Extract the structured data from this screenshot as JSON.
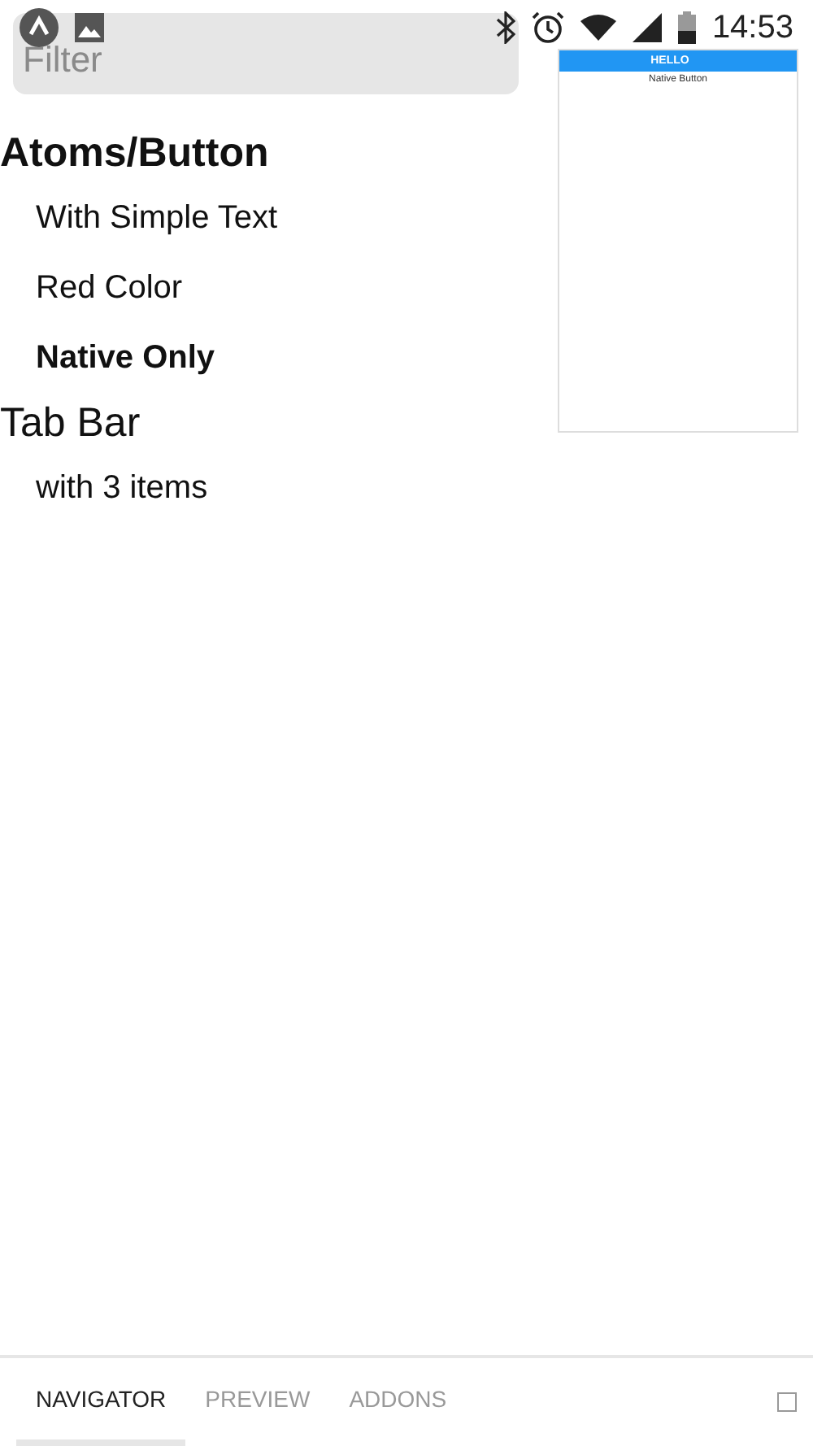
{
  "status_bar": {
    "time": "14:53"
  },
  "filter": {
    "placeholder": "Filter"
  },
  "stories": [
    {
      "name": "Atoms/Button",
      "selected": true,
      "children": [
        {
          "name": "With Simple Text",
          "selected": false
        },
        {
          "name": "Red Color",
          "selected": false
        },
        {
          "name": "Native Only",
          "selected": true
        }
      ]
    },
    {
      "name": "Tab Bar",
      "selected": false,
      "children": [
        {
          "name": "with 3 items",
          "selected": false
        }
      ]
    }
  ],
  "preview": {
    "header": "HELLO",
    "button": "Native Button"
  },
  "tabs": [
    {
      "label": "NAVIGATOR",
      "selected": true
    },
    {
      "label": "PREVIEW",
      "selected": false
    },
    {
      "label": "ADDONS",
      "selected": false
    }
  ]
}
